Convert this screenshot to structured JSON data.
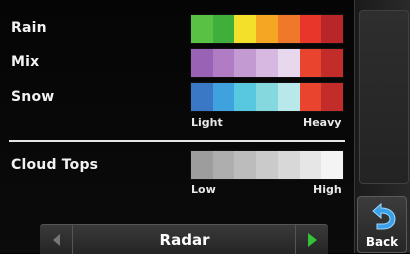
{
  "legend": {
    "rows": [
      {
        "label": "Rain",
        "colors": [
          "#59c245",
          "#3fae3a",
          "#f2e02a",
          "#f5a623",
          "#f0782a",
          "#e8372a",
          "#b8262a"
        ]
      },
      {
        "label": "Mix",
        "colors": [
          "#9a62b4",
          "#b07dc4",
          "#c39bd2",
          "#d6b8e1",
          "#e8d8ee",
          "#e8442e",
          "#c22d2a"
        ]
      },
      {
        "label": "Snow",
        "colors": [
          "#3a78c6",
          "#3fa2df",
          "#58c7e0",
          "#86d8df",
          "#b8e8ea",
          "#e8442e",
          "#c22d2a"
        ]
      }
    ],
    "precip_scale": {
      "low": "Light",
      "high": "Heavy"
    },
    "cloud_tops": {
      "label": "Cloud Tops",
      "colors": [
        "#9d9d9d",
        "#aeaeae",
        "#bcbcbc",
        "#cacaca",
        "#d8d8d8",
        "#e6e6e6",
        "#f4f4f4"
      ],
      "low": "Low",
      "high": "High"
    }
  },
  "selector": {
    "value": "Radar"
  },
  "back": {
    "label": "Back"
  }
}
